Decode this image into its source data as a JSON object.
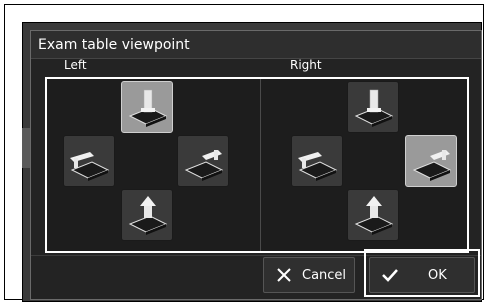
{
  "dialog": {
    "title": "Exam table viewpoint",
    "left_label": "Left",
    "right_label": "Right"
  },
  "buttons": {
    "cancel_label": "Cancel",
    "ok_label": "OK"
  },
  "viewpoints": {
    "left": {
      "top": "selected",
      "left": "unselected",
      "right": "unselected",
      "bottom": "unselected"
    },
    "right": {
      "top": "unselected",
      "left": "unselected",
      "right": "selected",
      "bottom": "unselected"
    }
  },
  "icons": {
    "viewpoint_top": "table-from-head-icon",
    "viewpoint_left": "table-from-left-icon",
    "viewpoint_right": "table-from-right-icon",
    "viewpoint_bottom": "table-from-foot-icon",
    "cancel": "x-icon",
    "ok": "check-icon"
  },
  "colors": {
    "dialog_bg": "#232323",
    "selected_button": "#9a9a9a",
    "button_bg": "#3a3a3a"
  }
}
